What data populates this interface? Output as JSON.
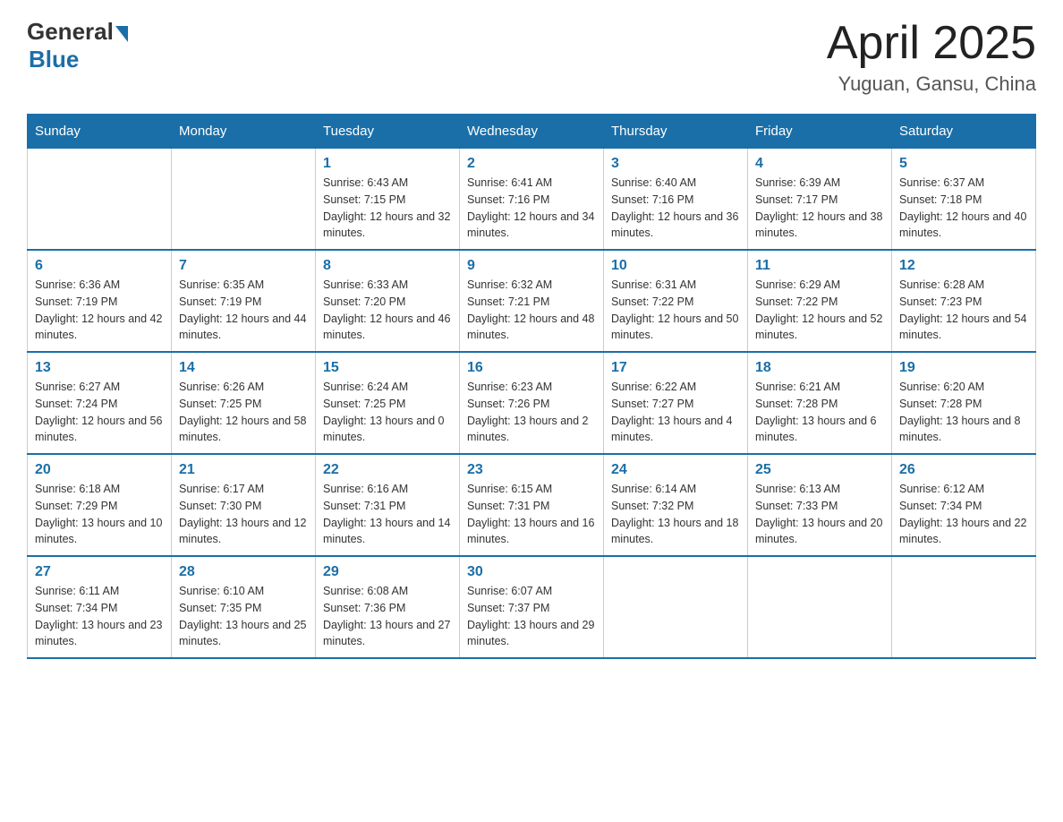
{
  "header": {
    "logo_general": "General",
    "logo_blue": "Blue",
    "month_title": "April 2025",
    "location": "Yuguan, Gansu, China"
  },
  "days_of_week": [
    "Sunday",
    "Monday",
    "Tuesday",
    "Wednesday",
    "Thursday",
    "Friday",
    "Saturday"
  ],
  "weeks": [
    [
      null,
      null,
      {
        "day": "1",
        "sunrise": "6:43 AM",
        "sunset": "7:15 PM",
        "daylight": "12 hours and 32 minutes."
      },
      {
        "day": "2",
        "sunrise": "6:41 AM",
        "sunset": "7:16 PM",
        "daylight": "12 hours and 34 minutes."
      },
      {
        "day": "3",
        "sunrise": "6:40 AM",
        "sunset": "7:16 PM",
        "daylight": "12 hours and 36 minutes."
      },
      {
        "day": "4",
        "sunrise": "6:39 AM",
        "sunset": "7:17 PM",
        "daylight": "12 hours and 38 minutes."
      },
      {
        "day": "5",
        "sunrise": "6:37 AM",
        "sunset": "7:18 PM",
        "daylight": "12 hours and 40 minutes."
      }
    ],
    [
      {
        "day": "6",
        "sunrise": "6:36 AM",
        "sunset": "7:19 PM",
        "daylight": "12 hours and 42 minutes."
      },
      {
        "day": "7",
        "sunrise": "6:35 AM",
        "sunset": "7:19 PM",
        "daylight": "12 hours and 44 minutes."
      },
      {
        "day": "8",
        "sunrise": "6:33 AM",
        "sunset": "7:20 PM",
        "daylight": "12 hours and 46 minutes."
      },
      {
        "day": "9",
        "sunrise": "6:32 AM",
        "sunset": "7:21 PM",
        "daylight": "12 hours and 48 minutes."
      },
      {
        "day": "10",
        "sunrise": "6:31 AM",
        "sunset": "7:22 PM",
        "daylight": "12 hours and 50 minutes."
      },
      {
        "day": "11",
        "sunrise": "6:29 AM",
        "sunset": "7:22 PM",
        "daylight": "12 hours and 52 minutes."
      },
      {
        "day": "12",
        "sunrise": "6:28 AM",
        "sunset": "7:23 PM",
        "daylight": "12 hours and 54 minutes."
      }
    ],
    [
      {
        "day": "13",
        "sunrise": "6:27 AM",
        "sunset": "7:24 PM",
        "daylight": "12 hours and 56 minutes."
      },
      {
        "day": "14",
        "sunrise": "6:26 AM",
        "sunset": "7:25 PM",
        "daylight": "12 hours and 58 minutes."
      },
      {
        "day": "15",
        "sunrise": "6:24 AM",
        "sunset": "7:25 PM",
        "daylight": "13 hours and 0 minutes."
      },
      {
        "day": "16",
        "sunrise": "6:23 AM",
        "sunset": "7:26 PM",
        "daylight": "13 hours and 2 minutes."
      },
      {
        "day": "17",
        "sunrise": "6:22 AM",
        "sunset": "7:27 PM",
        "daylight": "13 hours and 4 minutes."
      },
      {
        "day": "18",
        "sunrise": "6:21 AM",
        "sunset": "7:28 PM",
        "daylight": "13 hours and 6 minutes."
      },
      {
        "day": "19",
        "sunrise": "6:20 AM",
        "sunset": "7:28 PM",
        "daylight": "13 hours and 8 minutes."
      }
    ],
    [
      {
        "day": "20",
        "sunrise": "6:18 AM",
        "sunset": "7:29 PM",
        "daylight": "13 hours and 10 minutes."
      },
      {
        "day": "21",
        "sunrise": "6:17 AM",
        "sunset": "7:30 PM",
        "daylight": "13 hours and 12 minutes."
      },
      {
        "day": "22",
        "sunrise": "6:16 AM",
        "sunset": "7:31 PM",
        "daylight": "13 hours and 14 minutes."
      },
      {
        "day": "23",
        "sunrise": "6:15 AM",
        "sunset": "7:31 PM",
        "daylight": "13 hours and 16 minutes."
      },
      {
        "day": "24",
        "sunrise": "6:14 AM",
        "sunset": "7:32 PM",
        "daylight": "13 hours and 18 minutes."
      },
      {
        "day": "25",
        "sunrise": "6:13 AM",
        "sunset": "7:33 PM",
        "daylight": "13 hours and 20 minutes."
      },
      {
        "day": "26",
        "sunrise": "6:12 AM",
        "sunset": "7:34 PM",
        "daylight": "13 hours and 22 minutes."
      }
    ],
    [
      {
        "day": "27",
        "sunrise": "6:11 AM",
        "sunset": "7:34 PM",
        "daylight": "13 hours and 23 minutes."
      },
      {
        "day": "28",
        "sunrise": "6:10 AM",
        "sunset": "7:35 PM",
        "daylight": "13 hours and 25 minutes."
      },
      {
        "day": "29",
        "sunrise": "6:08 AM",
        "sunset": "7:36 PM",
        "daylight": "13 hours and 27 minutes."
      },
      {
        "day": "30",
        "sunrise": "6:07 AM",
        "sunset": "7:37 PM",
        "daylight": "13 hours and 29 minutes."
      },
      null,
      null,
      null
    ]
  ]
}
